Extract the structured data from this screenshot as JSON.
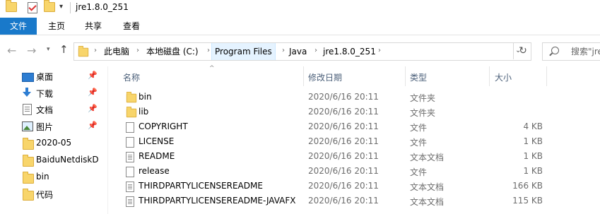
{
  "window": {
    "title": "jre1.8.0_251"
  },
  "ribbon": {
    "tabs": [
      "文件",
      "主页",
      "共享",
      "查看"
    ]
  },
  "address": {
    "crumbs": [
      "此电脑",
      "本地磁盘 (C:)",
      "Program Files",
      "Java",
      "jre1.8.0_251"
    ],
    "highlighted": "Program Files"
  },
  "search": {
    "placeholder": "搜索\"jre"
  },
  "sidebar": {
    "items": [
      {
        "label": "桌面",
        "icon": "desktop-icon",
        "pinned": true
      },
      {
        "label": "下载",
        "icon": "download-icon",
        "pinned": true
      },
      {
        "label": "文档",
        "icon": "document-icon",
        "pinned": true
      },
      {
        "label": "图片",
        "icon": "pictures-icon",
        "pinned": true
      },
      {
        "label": "2020-05",
        "icon": "folder-icon",
        "pinned": false
      },
      {
        "label": "BaiduNetdiskD",
        "icon": "folder-icon",
        "pinned": false
      },
      {
        "label": "bin",
        "icon": "folder-icon",
        "pinned": false
      },
      {
        "label": "代码",
        "icon": "folder-icon",
        "pinned": false
      }
    ]
  },
  "columns": {
    "name": "名称",
    "date": "修改日期",
    "type": "类型",
    "size": "大小"
  },
  "files": [
    {
      "name": "bin",
      "date": "2020/6/16 20:11",
      "type": "文件夹",
      "size": "",
      "icon": "folder-icon"
    },
    {
      "name": "lib",
      "date": "2020/6/16 20:11",
      "type": "文件夹",
      "size": "",
      "icon": "folder-icon"
    },
    {
      "name": "COPYRIGHT",
      "date": "2020/6/16 20:11",
      "type": "文件",
      "size": "4 KB",
      "icon": "file-icon"
    },
    {
      "name": "LICENSE",
      "date": "2020/6/16 20:11",
      "type": "文件",
      "size": "1 KB",
      "icon": "file-icon"
    },
    {
      "name": "README",
      "date": "2020/6/16 20:11",
      "type": "文本文档",
      "size": "1 KB",
      "icon": "text-file-icon"
    },
    {
      "name": "release",
      "date": "2020/6/16 20:11",
      "type": "文件",
      "size": "1 KB",
      "icon": "file-icon"
    },
    {
      "name": "THIRDPARTYLICENSEREADME",
      "date": "2020/6/16 20:11",
      "type": "文本文档",
      "size": "166 KB",
      "icon": "text-file-icon"
    },
    {
      "name": "THIRDPARTYLICENSEREADME-JAVAFX",
      "date": "2020/6/16 20:11",
      "type": "文本文档",
      "size": "115 KB",
      "icon": "text-file-icon"
    }
  ],
  "colors": {
    "accent": "#1979ca",
    "crumb_highlight": "#e5f3ff",
    "folder": "#f8d56b",
    "header_text": "#4c607a"
  }
}
